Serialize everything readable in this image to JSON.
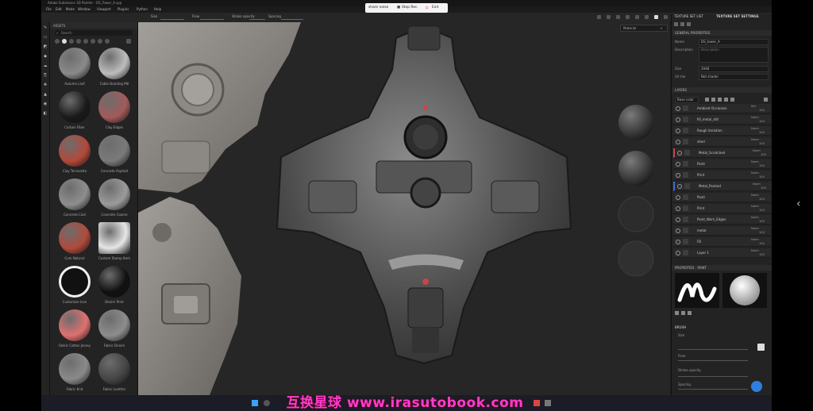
{
  "titlebar": {
    "title": "Adobe Substance 3D Painter - DS_Tower_A.spp"
  },
  "menu": [
    "File",
    "Edit",
    "Mode",
    "Window",
    "Viewport",
    "Plugins",
    "Python",
    "Help"
  ],
  "toolbar": {
    "size_label": "Size",
    "flow_label": "Flow",
    "stroke_opacity_label": "Stroke opacity",
    "spacing_label": "Spacing"
  },
  "recording": {
    "status": "share noise",
    "stop_label": "Stop Rec.",
    "exit_label": "Exit"
  },
  "assets": {
    "panel_title": "ASSETS",
    "search_placeholder": "Search",
    "items": [
      {
        "label": "Autumn Leaf",
        "color": "#8a8a8a",
        "icon": "leaf"
      },
      {
        "label": "Cable Braiding Mtl",
        "color": "#bdbdbd",
        "icon": "sphere"
      },
      {
        "label": "Carbon Fiber",
        "color": "#1a1a1a",
        "icon": "sphere"
      },
      {
        "label": "Clay Edges",
        "color": "#a35a5a",
        "icon": "sphere"
      },
      {
        "label": "Clay Terracotta",
        "color": "#b3493a",
        "icon": "sphere"
      },
      {
        "label": "Concrete Asphalt",
        "color": "#7a7a7a",
        "icon": "sphere"
      },
      {
        "label": "Concrete Cast",
        "color": "#8e8e8e",
        "icon": "sphere"
      },
      {
        "label": "Concrete Coarse",
        "color": "#9b9b9b",
        "icon": "sphere"
      },
      {
        "label": "Cork Natural",
        "color": "#b04a3c",
        "icon": "sphere"
      },
      {
        "label": "Custom Stamp Item",
        "color": "#e6e6e6",
        "icon": "stamp"
      },
      {
        "label": "Customize Icon",
        "color": "#f0f0f0",
        "icon": "smiley"
      },
      {
        "label": "Denim Print",
        "color": "#111111",
        "icon": "sphere"
      },
      {
        "label": "Fabric Cotton Jersey",
        "color": "#e07070",
        "icon": "sphere"
      },
      {
        "label": "Fabric Denim",
        "color": "#8d8d8d",
        "icon": "sphere"
      },
      {
        "label": "Fabric Knit",
        "color": "#8a8a8a",
        "icon": "sphere"
      },
      {
        "label": "Fabric Leather",
        "color": "#454545",
        "icon": "sphere"
      }
    ]
  },
  "viewport": {
    "mode_label": "Material"
  },
  "right_panel": {
    "tab_texture_set_list": "TEXTURE SET LIST",
    "tab_texture_set_settings": "TEXTURE SET SETTINGS",
    "general_properties": "GENERAL PROPERTIES",
    "name_label": "Name",
    "name_value": "DS_tower_A",
    "description_label": "Description",
    "description_placeholder": "Description",
    "size_label": "Size",
    "size_value": "2048",
    "uv_label": "UV tile",
    "uv_value": "Not shader",
    "layers_title": "LAYERS",
    "layers_filter": "Base color",
    "layers": [
      {
        "name": "Ambient Occlusion",
        "blend": "Mul",
        "opacity": "100"
      },
      {
        "name": "fill_metal_dirt",
        "blend": "Norm",
        "opacity": "100"
      },
      {
        "name": "Rough Variation",
        "blend": "Norm",
        "opacity": "100"
      },
      {
        "name": "steel",
        "blend": "Norm",
        "opacity": "100"
      },
      {
        "name": "Metal_Scratched",
        "blend": "Norm",
        "opacity": "100"
      },
      {
        "name": "Paint",
        "blend": "Norm",
        "opacity": "100"
      },
      {
        "name": "Print",
        "blend": "Norm",
        "opacity": "100"
      },
      {
        "name": "Metal_Painted",
        "blend": "Norm",
        "opacity": "100"
      },
      {
        "name": "Paint",
        "blend": "Norm",
        "opacity": "100"
      },
      {
        "name": "Print",
        "blend": "Norm",
        "opacity": "100"
      },
      {
        "name": "Paint_Worn_Edges",
        "blend": "Norm",
        "opacity": "100"
      },
      {
        "name": "metal",
        "blend": "Norm",
        "opacity": "100"
      },
      {
        "name": "Fill",
        "blend": "Norm",
        "opacity": "100"
      },
      {
        "name": "Layer 1",
        "blend": "Norm",
        "opacity": "100"
      }
    ],
    "properties_title": "PROPERTIES - PAINT",
    "brush_label": "BRUSH",
    "size_prop": "Size",
    "flow_prop": "Flow",
    "opacity_prop": "Stroke opacity",
    "spacing_prop": "Spacing"
  },
  "watermark": "互换星球 www.irasutobook.com"
}
